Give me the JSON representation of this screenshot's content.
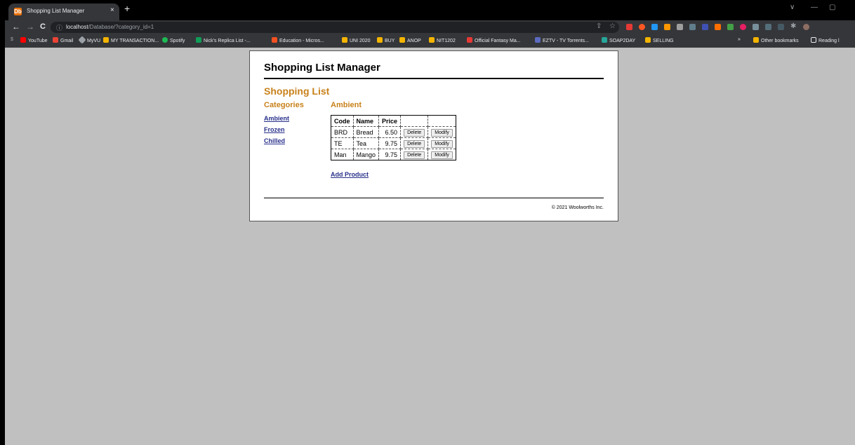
{
  "browser": {
    "tab": {
      "title": "Shopping List Manager",
      "favicon_glyph": "Db",
      "close_glyph": "×"
    },
    "new_tab_glyph": "+",
    "window_controls": [
      "∨",
      "—",
      "▢"
    ],
    "nav": {
      "back": "←",
      "forward": "→",
      "reload": "C"
    },
    "address": {
      "info_glyph": "ⓘ",
      "host": "localhost",
      "path": "/Database/?category_id=1"
    },
    "toolbar_glyphs": {
      "share": "⇪",
      "star": "☆",
      "extensions": "✱"
    },
    "bookmarks": [
      {
        "label": "YouTube",
        "color": "#ff0000"
      },
      {
        "label": "Gmail",
        "color": "#ea4335"
      },
      {
        "label": "MyVU",
        "color": "#9aa0a6"
      },
      {
        "label": "MY TRANSACTION...",
        "color": "#f4b400"
      },
      {
        "label": "Spotify",
        "color": "#1db954"
      },
      {
        "label": "Nick's Replica List -...",
        "color": "#0f9d58"
      },
      {
        "label": "Education - Micros...",
        "color": "#f25022"
      },
      {
        "label": "UNI 2020",
        "color": "#f4b400"
      },
      {
        "label": "BUY",
        "color": "#f4b400"
      },
      {
        "label": "ANOP",
        "color": "#f4b400"
      },
      {
        "label": "NIT1202",
        "color": "#f4b400"
      },
      {
        "label": "Official Fantasy Ma...",
        "color": "#e53935"
      },
      {
        "label": "EZTV - TV Torrents...",
        "color": "#5c6bc0"
      },
      {
        "label": "SOAP2DAY",
        "color": "#26a69a"
      },
      {
        "label": "SELLING",
        "color": "#f4b400"
      }
    ],
    "bookmarks_overflow": "»",
    "other_bookmarks": "Other bookmarks",
    "reading_list": "Reading l"
  },
  "page": {
    "site_title": "Shopping List Manager",
    "heading": "Shopping List",
    "categories_heading": "Categories",
    "categories": [
      "Ambient",
      "Frozen",
      "Chilled"
    ],
    "selected_category": "Ambient",
    "table": {
      "headers": [
        "Code",
        "Name",
        "Price",
        "",
        ""
      ],
      "rows": [
        {
          "code": "BRD",
          "name": "Bread",
          "price": "6.50"
        },
        {
          "code": "TE",
          "name": "Tea",
          "price": "9.75"
        },
        {
          "code": "Man",
          "name": "Mango",
          "price": "9.75"
        }
      ],
      "delete_label": "Delete",
      "modify_label": "Modify"
    },
    "add_product": "Add Product",
    "footer": "© 2021 Woolworths Inc."
  }
}
